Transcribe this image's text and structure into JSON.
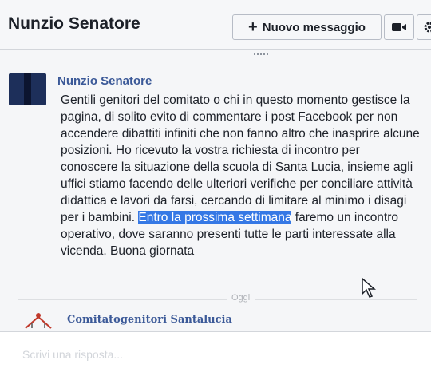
{
  "header": {
    "title": "Nunzio Senatore",
    "new_message_label": "Nuovo messaggio",
    "new_message_icon": "plus-icon",
    "video_icon": "video-camera-icon",
    "settings_icon": "gear-icon"
  },
  "message": {
    "sender": "Nunzio Senatore",
    "text_before": "Gentili genitori del comitato o chi in questo momento gestisce la pagina, di solito evito di commentare i post Facebook per non accendere dibattiti infiniti che non fanno altro che inasprire alcune posizioni. Ho ricevuto la vostra richiesta di incontro per conoscere la situazione della scuola di Santa Lucia, insieme agli uffici stiamo facendo delle ulteriori verifiche per conciliare attività didattica e lavori da farsi, cercando di limitare al minimo i disagi per i bambini.",
    "text_highlight": "Entro la prossima settimana",
    "text_after": "faremo un incontro operativo, dove saranno presenti tutte le parti interessate alla vicenda. Buona giornata"
  },
  "divider_label": "Oggi",
  "next_message": {
    "sender": "Comitatogenitori Santalucia"
  },
  "reply": {
    "placeholder": "Scrivi una risposta..."
  },
  "colors": {
    "link_blue": "#3b5998",
    "selection": "#3578e5"
  }
}
